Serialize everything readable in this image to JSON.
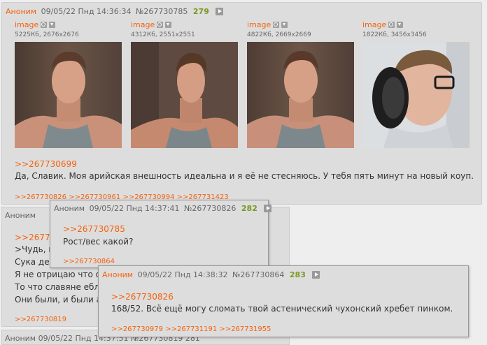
{
  "main_post": {
    "name": "Аноним",
    "date": "09/05/22 Пнд 14:36:34",
    "num": "№267730785",
    "count": "279",
    "images": [
      {
        "label": "image",
        "meta": "5225Кб, 2676x2676",
        "alt": "Фото 1"
      },
      {
        "label": "image",
        "meta": "4312Кб, 2551x2551",
        "alt": "Фото 2"
      },
      {
        "label": "image",
        "meta": "4822Кб, 2669x2669",
        "alt": "Фото 3"
      },
      {
        "label": "image",
        "meta": "1822Кб, 3456x3456",
        "alt": "Фото 4"
      }
    ],
    "reply_ref": ">>267730699",
    "text": "Да, Славик. Моя арийская внешность идеальна и я её не стесняюсь. У тебя пять минут на новый коуп.",
    "backrefs": [
      ">>267730826",
      ">>267730961",
      ">>267730994",
      ">>267731423"
    ]
  },
  "under_post": {
    "name": "Аноним",
    "reply_ref": ">>26773",
    "green_line": ">Чудь, в",
    "lines": [
      "Сука деб",
      "Я не отрицаю что он",
      "То что славяне ебли",
      "Они были, и были а"
    ],
    "backref": ">>267730819",
    "next_header": "Аноним  09/05/22 Пнд 14:37:51  №267730819  281"
  },
  "popup1": {
    "name": "Аноним",
    "date": "09/05/22 Пнд 14:37:41",
    "num": "№267730826",
    "count": "282",
    "reply_ref": ">>267730785",
    "text": "Рост/вес какой?",
    "backref": ">>267730864"
  },
  "popup2": {
    "name": "Аноним",
    "date": "09/05/22 Пнд 14:38:32",
    "num": "№267730864",
    "count": "283",
    "reply_ref": ">>267730826",
    "text": "168/52. Всё ещё могу сломать твой астенический чухонский хребет пинком.",
    "backrefs": [
      ">>267730979",
      ">>267731191",
      ">>267731955"
    ]
  }
}
